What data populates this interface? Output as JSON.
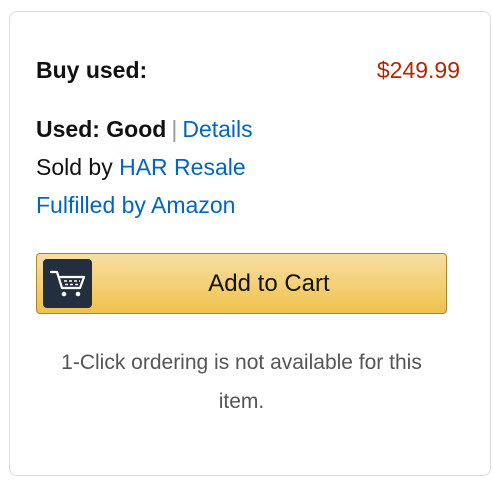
{
  "buybox": {
    "buy_used_label": "Buy used:",
    "price": "$249.99",
    "condition_label": "Used: Good",
    "separator": "|",
    "details_link": "Details",
    "sold_by_prefix": "Sold by",
    "seller_link": "HAR Resale",
    "fulfilled_link": "Fulfilled by Amazon",
    "add_to_cart_label": "Add to Cart",
    "one_click_note": "1-Click ordering is not available for this item."
  },
  "icons": {
    "cart": "shopping-cart-icon"
  },
  "colors": {
    "price": "#b12704",
    "link": "#0066c0",
    "button_top": "#f7dfa5",
    "button_bottom": "#f0c14b",
    "button_border": "#a88734",
    "icon_bg": "#232f3e"
  }
}
